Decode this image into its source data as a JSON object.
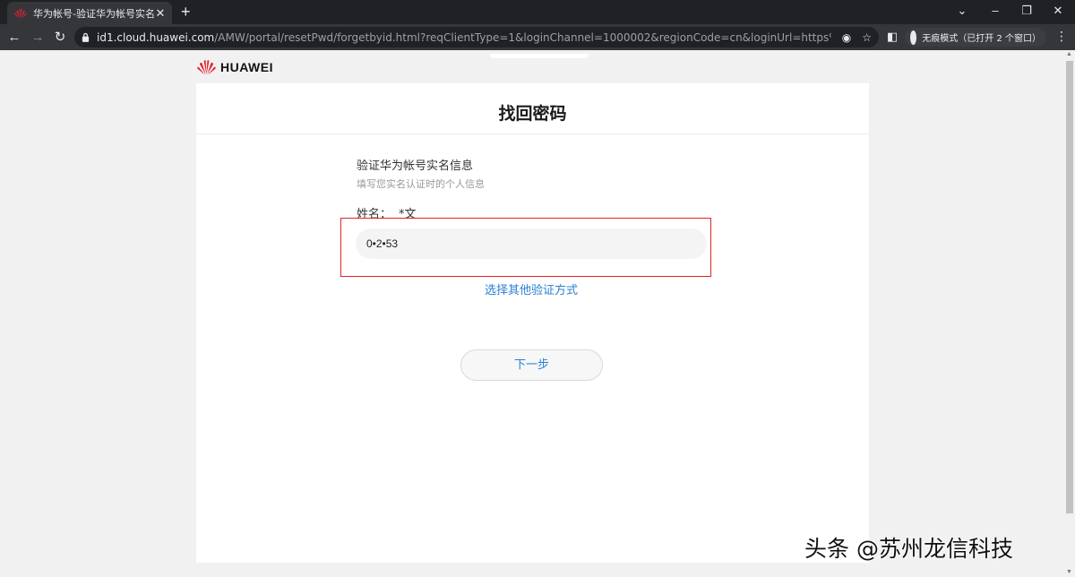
{
  "browser": {
    "tab_title": "华为帐号-验证华为帐号实名信息",
    "tab_close": "✕",
    "new_tab": "+",
    "url_host": "id1.cloud.huawei.com",
    "url_rest": "/AMW/portal/resetPwd/forgetbyid.html?reqClientType=1&loginChannel=1000002&regionCode=cn&loginUrl=https%3A%2F%2Fcl...",
    "profile_label": "无痕模式（已打开 2 个窗口）",
    "accent_color": "#35363a"
  },
  "page": {
    "logo_text": "HUAWEI",
    "title": "找回密码",
    "section_title": "验证华为帐号实名信息",
    "section_sub": "填写您实名认证时的个人信息",
    "name_label": "姓名：",
    "name_value": "*文",
    "id_value": "0•2•53",
    "other_method_link": "选择其他验证方式",
    "next_button": "下一步",
    "link_color": "#2a7fd4",
    "highlight_color": "#e02424"
  },
  "watermark": "头条 @苏州龙信科技"
}
